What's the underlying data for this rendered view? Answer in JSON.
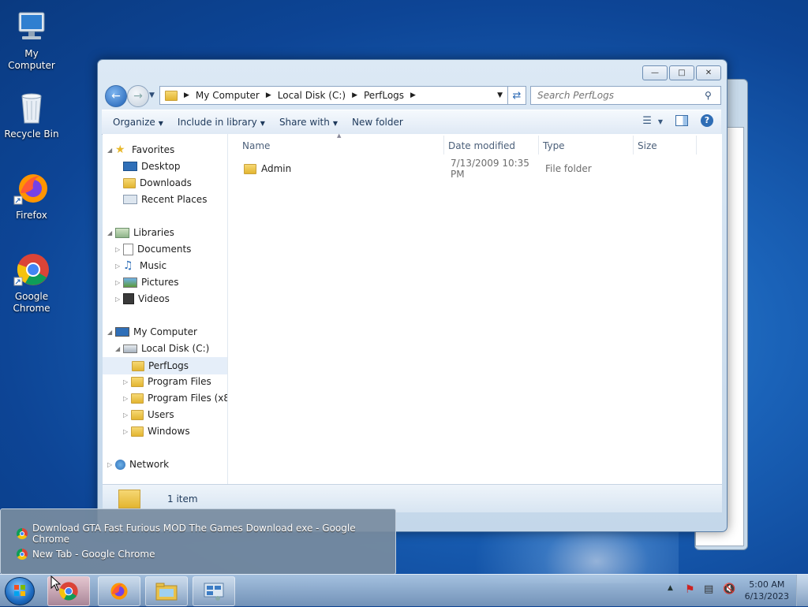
{
  "desktop": {
    "icons": [
      {
        "label": "My Computer"
      },
      {
        "label": "Recycle Bin"
      },
      {
        "label": "Firefox"
      },
      {
        "label": "Google Chrome"
      }
    ]
  },
  "explorer": {
    "address": {
      "crumbs": [
        "My Computer",
        "Local Disk (C:)",
        "PerfLogs"
      ]
    },
    "search_placeholder": "Search PerfLogs",
    "toolbar": {
      "organize": "Organize",
      "include_in_library": "Include in library",
      "share_with": "Share with",
      "new_folder": "New folder"
    },
    "nav": {
      "favorites": "Favorites",
      "desktop": "Desktop",
      "downloads": "Downloads",
      "recent_places": "Recent Places",
      "libraries": "Libraries",
      "documents": "Documents",
      "music": "Music",
      "pictures": "Pictures",
      "videos": "Videos",
      "my_computer": "My Computer",
      "local_disk": "Local Disk (C:)",
      "perflogs": "PerfLogs",
      "program_files": "Program Files",
      "program_files_x86": "Program Files (x86",
      "users": "Users",
      "windows": "Windows",
      "network": "Network"
    },
    "columns": {
      "name": "Name",
      "date_modified": "Date modified",
      "type": "Type",
      "size": "Size"
    },
    "files": [
      {
        "name": "Admin",
        "date_modified": "7/13/2009 10:35 PM",
        "type": "File folder",
        "size": ""
      }
    ],
    "status": "1 item"
  },
  "jumplist": {
    "items": [
      {
        "label": "Download GTA Fast Furious MOD The Games Download exe - Google Chrome"
      },
      {
        "label": "New Tab - Google Chrome"
      }
    ]
  },
  "taskbar": {
    "clock": {
      "time": "5:00 AM",
      "date": "6/13/2023"
    }
  }
}
